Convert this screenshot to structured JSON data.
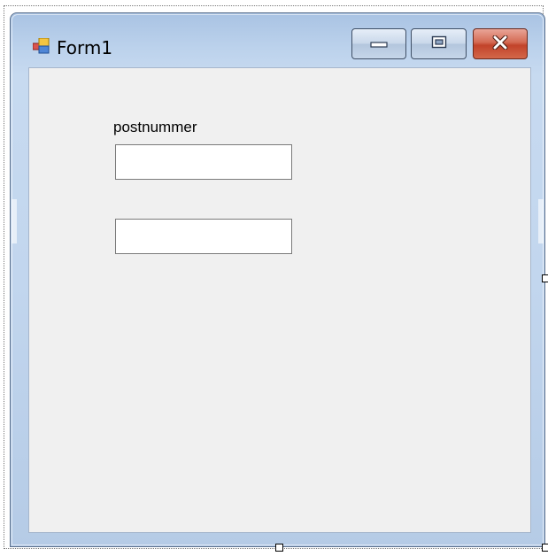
{
  "window": {
    "title": "Form1",
    "icon": "form-icon",
    "controls": {
      "minimize_icon": "minimize-icon",
      "maximize_icon": "maximize-icon",
      "close_icon": "close-icon"
    }
  },
  "form": {
    "label_text": "postnummer",
    "textbox1": {
      "value": ""
    },
    "textbox2": {
      "value": ""
    }
  },
  "colors": {
    "client_background": "#f0f0f0",
    "close_button": "#c2432a",
    "frame": "#c2d6ee"
  }
}
